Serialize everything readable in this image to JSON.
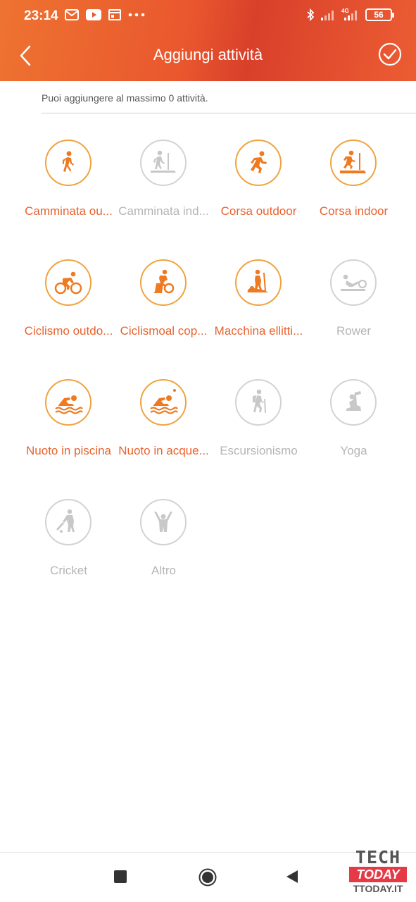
{
  "status_bar": {
    "time": "23:14",
    "network_label": "4G",
    "battery": "56",
    "left_icons": [
      "gmail-icon",
      "youtube-icon",
      "calendar-icon",
      "more-dots-icon"
    ],
    "right_icons": [
      "bluetooth-icon",
      "signal-icon",
      "signal-4g-icon",
      "battery-icon"
    ]
  },
  "app_bar": {
    "title": "Aggiungi attività",
    "back_icon": "chevron-left-icon",
    "confirm_icon": "check-circle-icon"
  },
  "info_text": "Puoi aggiungere al massimo 0 attività.",
  "colors": {
    "header": "#e9572e",
    "active": "#e9622e",
    "active_icon": "#f0a341",
    "disabled": "#b5b5b5"
  },
  "activities": [
    {
      "label": "Camminata ou...",
      "icon": "walking-icon",
      "enabled": true
    },
    {
      "label": "Camminata ind...",
      "icon": "treadmill-walk-icon",
      "enabled": false
    },
    {
      "label": "Corsa outdoor",
      "icon": "running-icon",
      "enabled": true
    },
    {
      "label": "Corsa indoor",
      "icon": "treadmill-run-icon",
      "enabled": true
    },
    {
      "label": "Ciclismo outdo...",
      "icon": "cycling-icon",
      "enabled": true
    },
    {
      "label": "Ciclismoal cop...",
      "icon": "indoor-cycling-icon",
      "enabled": true
    },
    {
      "label": "Macchina ellitti...",
      "icon": "elliptical-icon",
      "enabled": true
    },
    {
      "label": "Rower",
      "icon": "rower-icon",
      "enabled": false
    },
    {
      "label": "Nuoto in piscina",
      "icon": "pool-swim-icon",
      "enabled": true
    },
    {
      "label": "Nuoto in acque...",
      "icon": "open-water-swim-icon",
      "enabled": true
    },
    {
      "label": "Escursionismo",
      "icon": "hiking-icon",
      "enabled": false
    },
    {
      "label": "Yoga",
      "icon": "yoga-icon",
      "enabled": false
    },
    {
      "label": "Cricket",
      "icon": "cricket-icon",
      "enabled": false
    },
    {
      "label": "Altro",
      "icon": "other-activity-icon",
      "enabled": false
    }
  ],
  "nav_bar": {
    "icons": [
      "recent-apps-icon",
      "home-icon",
      "back-triangle-icon"
    ]
  },
  "watermark": {
    "line1": "TECH",
    "line2": "TODAY",
    "line3": "TTODAY.IT"
  }
}
